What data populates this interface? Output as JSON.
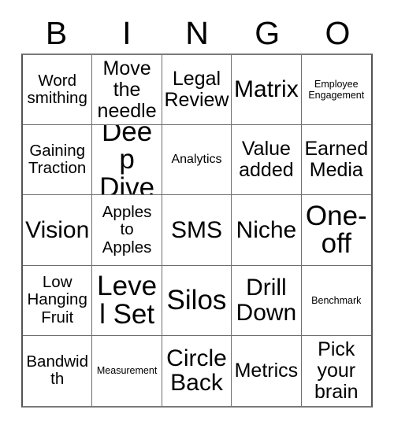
{
  "header": {
    "letters": [
      "B",
      "I",
      "N",
      "G",
      "O"
    ]
  },
  "grid": {
    "columns": 5,
    "rows": 5,
    "cells": [
      {
        "text": "Word smithing",
        "size": "fs-m"
      },
      {
        "text": "Move the needle",
        "size": "fs-l"
      },
      {
        "text": "Legal Review",
        "size": "fs-l"
      },
      {
        "text": "Matrix",
        "size": "fs-xl"
      },
      {
        "text": "Employee Engagement",
        "size": "fs-xs"
      },
      {
        "text": "Gaining Traction",
        "size": "fs-m"
      },
      {
        "text": "Deep Dive",
        "size": "fs-xxl"
      },
      {
        "text": "Analytics",
        "size": "fs-s"
      },
      {
        "text": "Value added",
        "size": "fs-l"
      },
      {
        "text": "Earned Media",
        "size": "fs-l"
      },
      {
        "text": "Vision",
        "size": "fs-xl"
      },
      {
        "text": "Apples to Apples",
        "size": "fs-m"
      },
      {
        "text": "SMS",
        "size": "fs-xl"
      },
      {
        "text": "Niche",
        "size": "fs-xl"
      },
      {
        "text": "One-off",
        "size": "fs-xxl"
      },
      {
        "text": "Low Hanging Fruit",
        "size": "fs-m"
      },
      {
        "text": "Level Set",
        "size": "fs-xxl"
      },
      {
        "text": "Silos",
        "size": "fs-xxl"
      },
      {
        "text": "Drill Down",
        "size": "fs-xl"
      },
      {
        "text": "Benchmark",
        "size": "fs-xs"
      },
      {
        "text": "Bandwidth",
        "size": "fs-m"
      },
      {
        "text": "Measurement",
        "size": "fs-xs"
      },
      {
        "text": "Circle Back",
        "size": "fs-xl"
      },
      {
        "text": "Metrics",
        "size": "fs-l"
      },
      {
        "text": "Pick your brain",
        "size": "fs-l"
      }
    ]
  },
  "colors": {
    "background": "#ffffff",
    "text": "#000000",
    "grid_line": "#6e6e6e",
    "grid_border": "#555555"
  }
}
